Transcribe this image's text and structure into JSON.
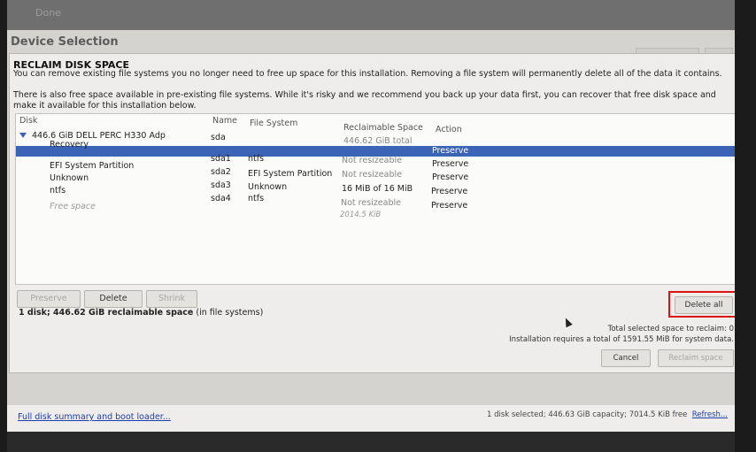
{
  "topbar": {
    "done_label": "Done"
  },
  "background": {
    "title": "Device Selection"
  },
  "dialog": {
    "title": "RECLAIM DISK SPACE",
    "desc1": "You can remove existing file systems you no longer need to free up space for this installation.  Removing a file system will permanently delete all of the data it contains.",
    "desc2": "There is also free space available in pre-existing file systems.  While it's risky and we recommend you back up your data first, you can recover that free disk space and make it available for this installation below.",
    "columns": {
      "disk": "Disk",
      "name": "Name",
      "fs": "File System",
      "reclaimable": "Reclaimable Space",
      "action": "Action"
    },
    "rows": [
      {
        "disk": "446.6 GiB DELL PERC H330 Adp",
        "name": "sda",
        "fs": "",
        "reclaimable": "446.62 GiB total",
        "action": "Preserve"
      },
      {
        "disk": "Recovery",
        "name": "sda1",
        "fs": "ntfs",
        "reclaimable": "Not resizeable",
        "action": "Preserve"
      },
      {
        "disk": "EFI System Partition",
        "name": "sda2",
        "fs": "EFI System Partition",
        "reclaimable": "Not resizeable",
        "action": "Preserve"
      },
      {
        "disk": "Unknown",
        "name": "sda3",
        "fs": "Unknown",
        "reclaimable": "16 MiB of 16 MiB",
        "action": "Preserve"
      },
      {
        "disk": "ntfs",
        "name": "sda4",
        "fs": "ntfs",
        "reclaimable": "Not resizeable",
        "action": "Preserve"
      },
      {
        "disk": "Free space",
        "name": "",
        "fs": "",
        "reclaimable": "2014.5 KiB",
        "action": ""
      }
    ],
    "buttons": {
      "preserve": "Preserve",
      "delete": "Delete",
      "shrink": "Shrink",
      "delete_all": "Delete all",
      "cancel": "Cancel",
      "reclaim": "Reclaim space"
    },
    "summary_bold": "1 disk; 446.62 GiB reclaimable space",
    "summary_rest": " (in file systems)",
    "info1": "Total selected space to reclaim: 0",
    "info2": "Installation requires a total of 1591.55 MiB for system data."
  },
  "bottom": {
    "link": "Full disk summary and boot loader...",
    "status": "1 disk selected; 446.63 GiB capacity; 7014.5 KiB free",
    "refresh": "Refresh..."
  },
  "colors": {
    "selection": "#3b63b6",
    "highlight_border": "#dd1111",
    "link": "#1d3cad"
  }
}
